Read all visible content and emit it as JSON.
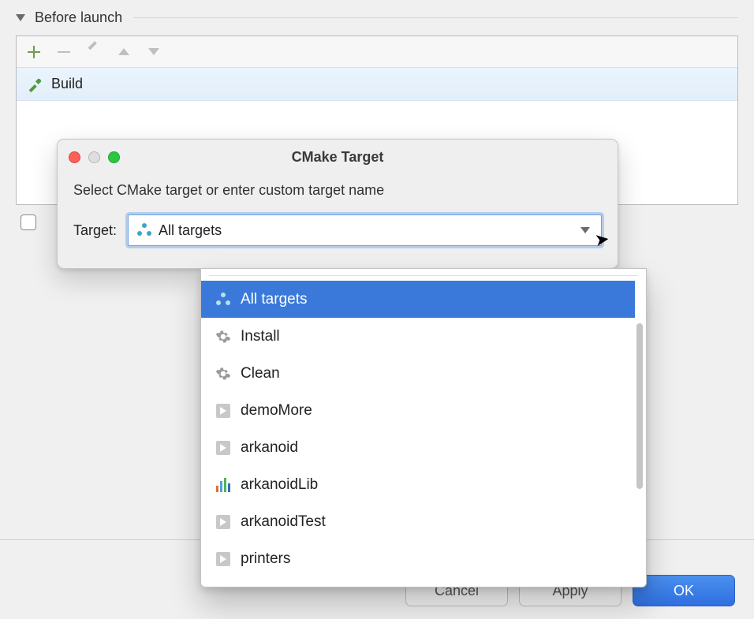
{
  "section": {
    "title": "Before launch"
  },
  "list": {
    "items": [
      {
        "label": "Build"
      }
    ]
  },
  "footer": {
    "cancel": "Cancel",
    "apply": "Apply",
    "ok": "OK"
  },
  "dialog": {
    "title": "CMake Target",
    "description": "Select CMake target or enter custom target name",
    "target_label": "Target:",
    "combo_value": "All targets"
  },
  "dropdown": {
    "items": [
      {
        "label": "All targets",
        "icon": "all-targets",
        "selected": true
      },
      {
        "label": "Install",
        "icon": "gear"
      },
      {
        "label": "Clean",
        "icon": "gear"
      },
      {
        "label": "demoMore",
        "icon": "play"
      },
      {
        "label": "arkanoid",
        "icon": "play"
      },
      {
        "label": "arkanoidLib",
        "icon": "bars"
      },
      {
        "label": "arkanoidTest",
        "icon": "play"
      },
      {
        "label": "printers",
        "icon": "play"
      }
    ]
  }
}
